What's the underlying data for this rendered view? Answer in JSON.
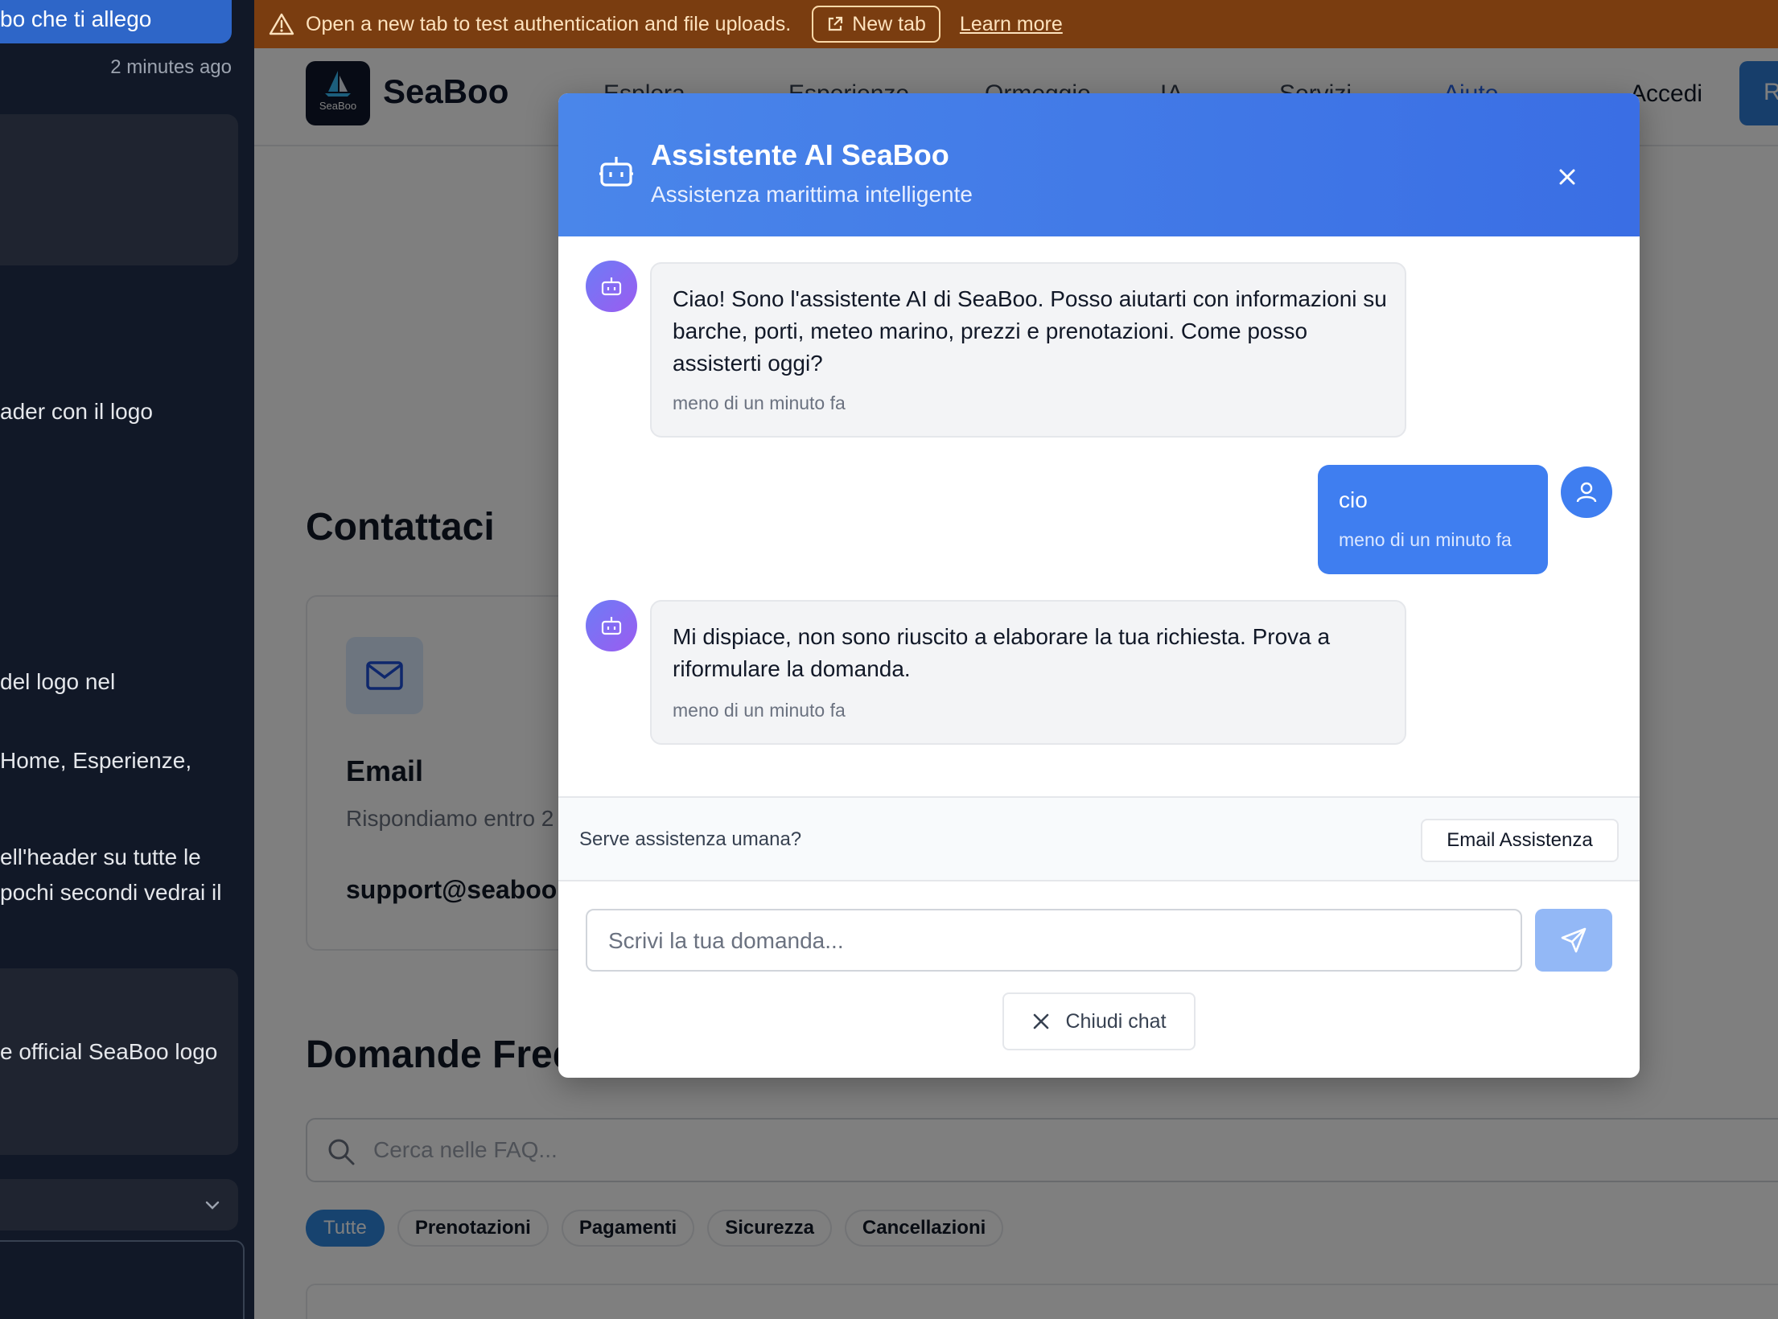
{
  "left_panel": {
    "message_top": "bo che ti allego",
    "timestamp": "2 minutes ago",
    "snippets": [
      "ader con il logo",
      " del logo nel",
      "Home, Esperienze,",
      "ell'header su tutte le",
      "pochi secondi vedrai il",
      "e official SeaBoo logo"
    ]
  },
  "banner": {
    "message": "Open a new tab to test authentication and file uploads.",
    "new_tab_label": "New tab",
    "learn_more_label": "Learn more",
    "color": "#7a3d10"
  },
  "site": {
    "logo_small_text": "SeaBoo",
    "brand": "SeaBoo",
    "nav": [
      "Esplora",
      "Esperienze",
      "Ormeggio",
      "IA",
      "Servizi",
      "Aiuto"
    ],
    "login_label": "Accedi",
    "register_label_partial": "R",
    "contact_title": "Contattaci",
    "email_card": {
      "title": "Email",
      "subtitle": "Rispondiamo entro 2",
      "address": "support@seaboo."
    },
    "faq_title": "Domande Freq",
    "faq_search_placeholder": "Cerca nelle FAQ...",
    "faq_chips": [
      "Tutte",
      "Prenotazioni",
      "Pagamenti",
      "Sicurezza",
      "Cancellazioni"
    ]
  },
  "chat": {
    "title": "Assistente AI SeaBoo",
    "subtitle": "Assistenza marittima intelligente",
    "messages": [
      {
        "role": "bot",
        "text": "Ciao! Sono l'assistente AI di SeaBoo. Posso aiutarti con informazioni su barche, porti, meteo marino, prezzi e prenotazioni. Come posso assisterti oggi?",
        "time": "meno di un minuto fa"
      },
      {
        "role": "user",
        "text": "cio",
        "time": "meno di un minuto fa"
      },
      {
        "role": "bot",
        "text": "Mi dispiace, non sono riuscito a elaborare la tua richiesta. Prova a riformulare la domanda.",
        "time": "meno di un minuto fa"
      }
    ],
    "human_help_text": "Serve assistenza umana?",
    "email_support_label": "Email Assistenza",
    "input_placeholder": "Scrivi la tua domanda...",
    "close_chat_label": "Chiudi chat",
    "header_color": "#4a86ea",
    "user_bubble_color": "#3f7ef0"
  }
}
